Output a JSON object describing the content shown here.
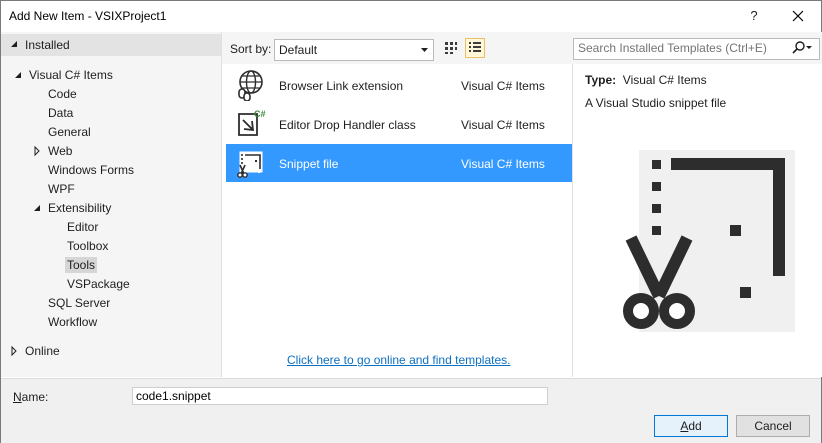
{
  "window": {
    "title": "Add New Item - VSIXProject1",
    "help_glyph": "?"
  },
  "left": {
    "installed_label": "Installed",
    "online_label": "Online",
    "tree": [
      {
        "label": "Visual C# Items"
      },
      {
        "label": "Code"
      },
      {
        "label": "Data"
      },
      {
        "label": "General"
      },
      {
        "label": "Web"
      },
      {
        "label": "Windows Forms"
      },
      {
        "label": "WPF"
      },
      {
        "label": "Extensibility"
      },
      {
        "label": "Editor"
      },
      {
        "label": "Toolbox"
      },
      {
        "label": "Tools"
      },
      {
        "label": "VSPackage"
      },
      {
        "label": "SQL Server"
      },
      {
        "label": "Workflow"
      }
    ]
  },
  "toolbar": {
    "sort_label": "Sort by:",
    "sort_value": "Default",
    "search_placeholder": "Search Installed Templates (Ctrl+E)"
  },
  "templates": [
    {
      "name": "Browser Link extension",
      "category": "Visual C# Items",
      "icon": "globe-link-icon"
    },
    {
      "name": "Editor Drop Handler class",
      "category": "Visual C# Items",
      "icon": "drop-handler-icon"
    },
    {
      "name": "Snippet file",
      "category": "Visual C# Items",
      "icon": "snippet-icon",
      "selected": true
    }
  ],
  "online_link": "Click here to go online and find templates.",
  "details": {
    "type_label": "Type:",
    "type_value": "Visual C# Items",
    "description": "A Visual Studio snippet file"
  },
  "bottom": {
    "name_label_prefix": "N",
    "name_label_rest": "ame:",
    "name_value": "code1.snippet",
    "add_prefix": "A",
    "add_rest": "dd",
    "cancel_label": "Cancel"
  },
  "colors": {
    "selection": "#3399ff",
    "link": "#0e70c0",
    "default_button_border": "#0078d7"
  }
}
